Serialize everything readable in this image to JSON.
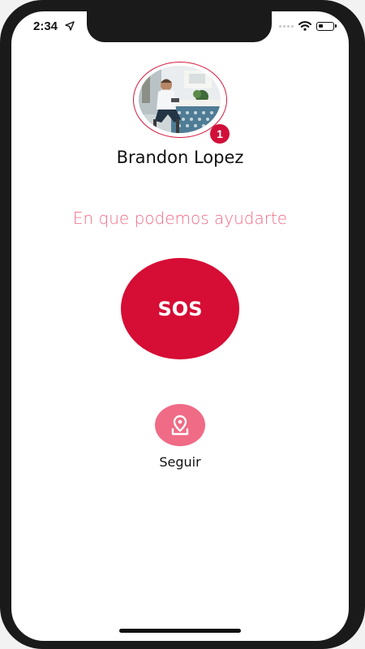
{
  "status_bar": {
    "time": "2:34"
  },
  "profile": {
    "name": "Brandon Lopez",
    "notification_count": "1"
  },
  "main": {
    "help_prompt": "En que podemos ayudarte",
    "sos_label": "SOS",
    "follow_label": "Seguir"
  },
  "colors": {
    "accent_red": "#d60d35",
    "accent_pink": "#f06b86"
  },
  "icons": {
    "status_location": "location-arrow-icon",
    "wifi": "wifi-icon",
    "battery": "battery-icon",
    "follow": "map-pin-icon"
  }
}
